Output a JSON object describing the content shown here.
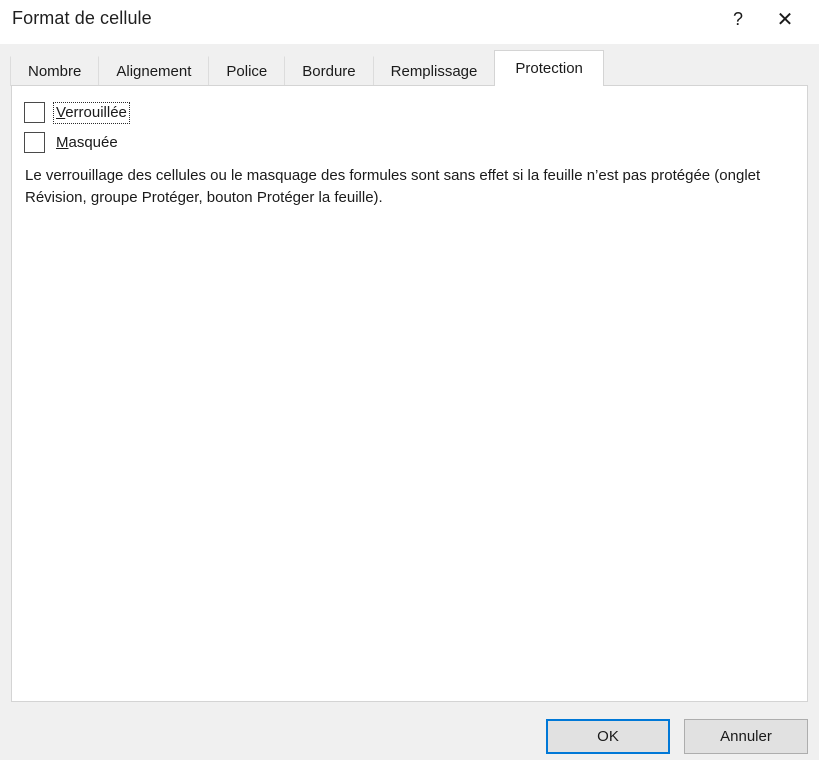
{
  "window": {
    "title": "Format de cellule",
    "help_icon": "help-question-icon",
    "help_glyph": "?",
    "close_icon": "close-x-icon",
    "close_glyph": "✕"
  },
  "tabs": [
    {
      "label": "Nombre",
      "active": false
    },
    {
      "label": "Alignement",
      "active": false
    },
    {
      "label": "Police",
      "active": false
    },
    {
      "label": "Bordure",
      "active": false
    },
    {
      "label": "Remplissage",
      "active": false
    },
    {
      "label": "Protection",
      "active": true
    }
  ],
  "panel": {
    "checkboxes": [
      {
        "name": "locked",
        "accel": "V",
        "label_rest": "errouillée",
        "checked": false,
        "focused": true
      },
      {
        "name": "hidden",
        "accel": "M",
        "label_rest": "asquée",
        "checked": false,
        "focused": false
      }
    ],
    "description": "Le verrouillage des cellules ou le masquage des formules sont sans effet si la feuille n’est pas protégée (onglet Révision, groupe Protéger, bouton Protéger la feuille)."
  },
  "footer": {
    "ok_label": "OK",
    "cancel_label": "Annuler"
  },
  "colors": {
    "accent": "#0078d7",
    "window_bg": "#f0f0f0",
    "panel_bg": "#ffffff",
    "titlebar_bg": "#ffffff",
    "border": "#d4d4d4",
    "button_face": "#e1e1e1",
    "button_border": "#adadad",
    "text": "#1a1a1a"
  }
}
